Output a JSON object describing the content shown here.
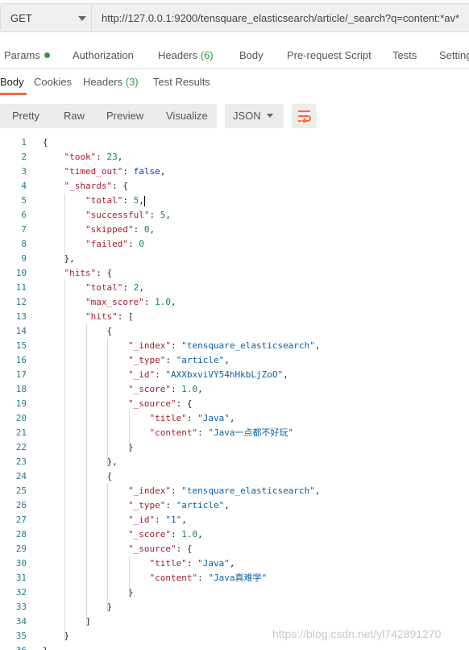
{
  "request": {
    "method": "GET",
    "url": "http://127.0.0.1:9200/tensquare_elasticsearch/article/_search?q=content:*av*"
  },
  "request_tabs": [
    {
      "label": "Params",
      "suffix": ""
    },
    {
      "label": "Authorization",
      "suffix": ""
    },
    {
      "label": "Headers ",
      "suffix": "(6)"
    },
    {
      "label": "Body",
      "suffix": ""
    },
    {
      "label": "Pre-request Script",
      "suffix": ""
    },
    {
      "label": "Tests",
      "suffix": ""
    },
    {
      "label": "Settings",
      "suffix": ""
    }
  ],
  "response_tabs": [
    {
      "label": "Body",
      "suffix": ""
    },
    {
      "label": "Cookies",
      "suffix": ""
    },
    {
      "label": "Headers ",
      "suffix": "(3)"
    },
    {
      "label": "Test Results",
      "suffix": ""
    }
  ],
  "format_buttons": [
    "Pretty",
    "Raw",
    "Preview",
    "Visualize"
  ],
  "format_select": "JSON",
  "wrap_icon": "text-wrap-icon",
  "accent_color": "#f26b3a",
  "code_lines": [
    [
      [
        "p",
        "{"
      ]
    ],
    [
      [
        "k",
        "\"took\""
      ],
      [
        "p",
        ": "
      ],
      [
        "n",
        "23"
      ],
      [
        "p",
        ","
      ]
    ],
    [
      [
        "k",
        "\"timed_out\""
      ],
      [
        "p",
        ": "
      ],
      [
        "b",
        "false"
      ],
      [
        "p",
        ","
      ]
    ],
    [
      [
        "k",
        "\"_shards\""
      ],
      [
        "p",
        ": {"
      ]
    ],
    [
      [
        "k",
        "\"total\""
      ],
      [
        "p",
        ": "
      ],
      [
        "n",
        "5"
      ],
      [
        "p",
        ","
      ]
    ],
    [
      [
        "k",
        "\"successful\""
      ],
      [
        "p",
        ": "
      ],
      [
        "n",
        "5"
      ],
      [
        "p",
        ","
      ]
    ],
    [
      [
        "k",
        "\"skipped\""
      ],
      [
        "p",
        ": "
      ],
      [
        "n",
        "0"
      ],
      [
        "p",
        ","
      ]
    ],
    [
      [
        "k",
        "\"failed\""
      ],
      [
        "p",
        ": "
      ],
      [
        "n",
        "0"
      ]
    ],
    [
      [
        "p",
        "},"
      ]
    ],
    [
      [
        "k",
        "\"hits\""
      ],
      [
        "p",
        ": {"
      ]
    ],
    [
      [
        "k",
        "\"total\""
      ],
      [
        "p",
        ": "
      ],
      [
        "n",
        "2"
      ],
      [
        "p",
        ","
      ]
    ],
    [
      [
        "k",
        "\"max_score\""
      ],
      [
        "p",
        ": "
      ],
      [
        "n",
        "1.0"
      ],
      [
        "p",
        ","
      ]
    ],
    [
      [
        "k",
        "\"hits\""
      ],
      [
        "p",
        ": ["
      ]
    ],
    [
      [
        "p",
        "{"
      ]
    ],
    [
      [
        "k",
        "\"_index\""
      ],
      [
        "p",
        ": "
      ],
      [
        "s",
        "\"tensquare_elasticsearch\""
      ],
      [
        "p",
        ","
      ]
    ],
    [
      [
        "k",
        "\"_type\""
      ],
      [
        "p",
        ": "
      ],
      [
        "s",
        "\"article\""
      ],
      [
        "p",
        ","
      ]
    ],
    [
      [
        "k",
        "\"_id\""
      ],
      [
        "p",
        ": "
      ],
      [
        "s",
        "\"AXXbxviVY54hHkbLjZoO\""
      ],
      [
        "p",
        ","
      ]
    ],
    [
      [
        "k",
        "\"_score\""
      ],
      [
        "p",
        ": "
      ],
      [
        "n",
        "1.0"
      ],
      [
        "p",
        ","
      ]
    ],
    [
      [
        "k",
        "\"_source\""
      ],
      [
        "p",
        ": {"
      ]
    ],
    [
      [
        "k",
        "\"title\""
      ],
      [
        "p",
        ": "
      ],
      [
        "s",
        "\"Java\""
      ],
      [
        "p",
        ","
      ]
    ],
    [
      [
        "k",
        "\"content\""
      ],
      [
        "p",
        ": "
      ],
      [
        "s",
        "\"Java一点都不好玩\""
      ]
    ],
    [
      [
        "p",
        "}"
      ]
    ],
    [
      [
        "p",
        "},"
      ]
    ],
    [
      [
        "p",
        "{"
      ]
    ],
    [
      [
        "k",
        "\"_index\""
      ],
      [
        "p",
        ": "
      ],
      [
        "s",
        "\"tensquare_elasticsearch\""
      ],
      [
        "p",
        ","
      ]
    ],
    [
      [
        "k",
        "\"_type\""
      ],
      [
        "p",
        ": "
      ],
      [
        "s",
        "\"article\""
      ],
      [
        "p",
        ","
      ]
    ],
    [
      [
        "k",
        "\"_id\""
      ],
      [
        "p",
        ": "
      ],
      [
        "s",
        "\"1\""
      ],
      [
        "p",
        ","
      ]
    ],
    [
      [
        "k",
        "\"_score\""
      ],
      [
        "p",
        ": "
      ],
      [
        "n",
        "1.0"
      ],
      [
        "p",
        ","
      ]
    ],
    [
      [
        "k",
        "\"_source\""
      ],
      [
        "p",
        ": {"
      ]
    ],
    [
      [
        "k",
        "\"title\""
      ],
      [
        "p",
        ": "
      ],
      [
        "s",
        "\"Java\""
      ],
      [
        "p",
        ","
      ]
    ],
    [
      [
        "k",
        "\"content\""
      ],
      [
        "p",
        ": "
      ],
      [
        "s",
        "\"Java真难学\""
      ]
    ],
    [
      [
        "p",
        "}"
      ]
    ],
    [
      [
        "p",
        "}"
      ]
    ],
    [
      [
        "p",
        "]"
      ]
    ],
    [
      [
        "p",
        "}"
      ]
    ],
    [
      [
        "p",
        "}"
      ]
    ]
  ],
  "watermark": "https://blog.csdn.net/yl742891270"
}
